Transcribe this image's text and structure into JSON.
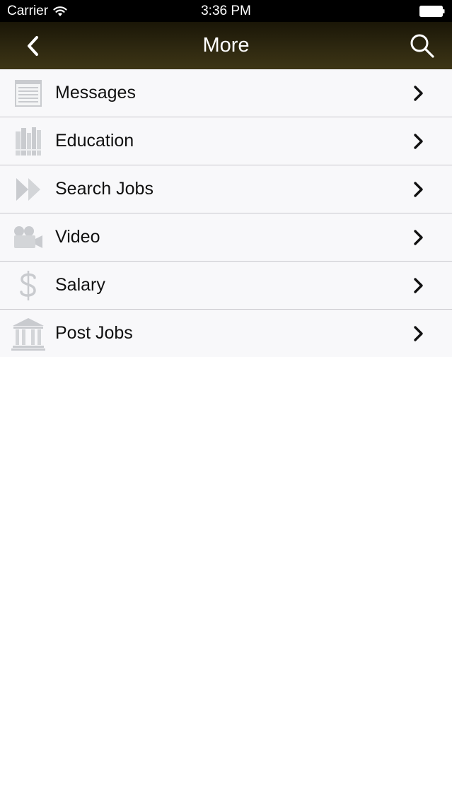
{
  "status_bar": {
    "carrier": "Carrier",
    "time": "3:36 PM"
  },
  "nav": {
    "title": "More",
    "back_icon": "chevron-left-icon",
    "search_icon": "search-icon"
  },
  "menu": {
    "items": [
      {
        "label": "Messages",
        "icon": "messages-list-icon"
      },
      {
        "label": "Education",
        "icon": "books-icon"
      },
      {
        "label": "Search Jobs",
        "icon": "fast-forward-icon"
      },
      {
        "label": "Video",
        "icon": "video-camera-icon"
      },
      {
        "label": "Salary",
        "icon": "dollar-sign-icon"
      },
      {
        "label": "Post Jobs",
        "icon": "building-columns-icon"
      }
    ]
  },
  "colors": {
    "status_bar_bg": "#000000",
    "nav_bar_bg": "#2e2810",
    "row_bg": "#f8f8fa",
    "separator": "#c8c7cc",
    "icon_gray": "#c9cbcf"
  }
}
